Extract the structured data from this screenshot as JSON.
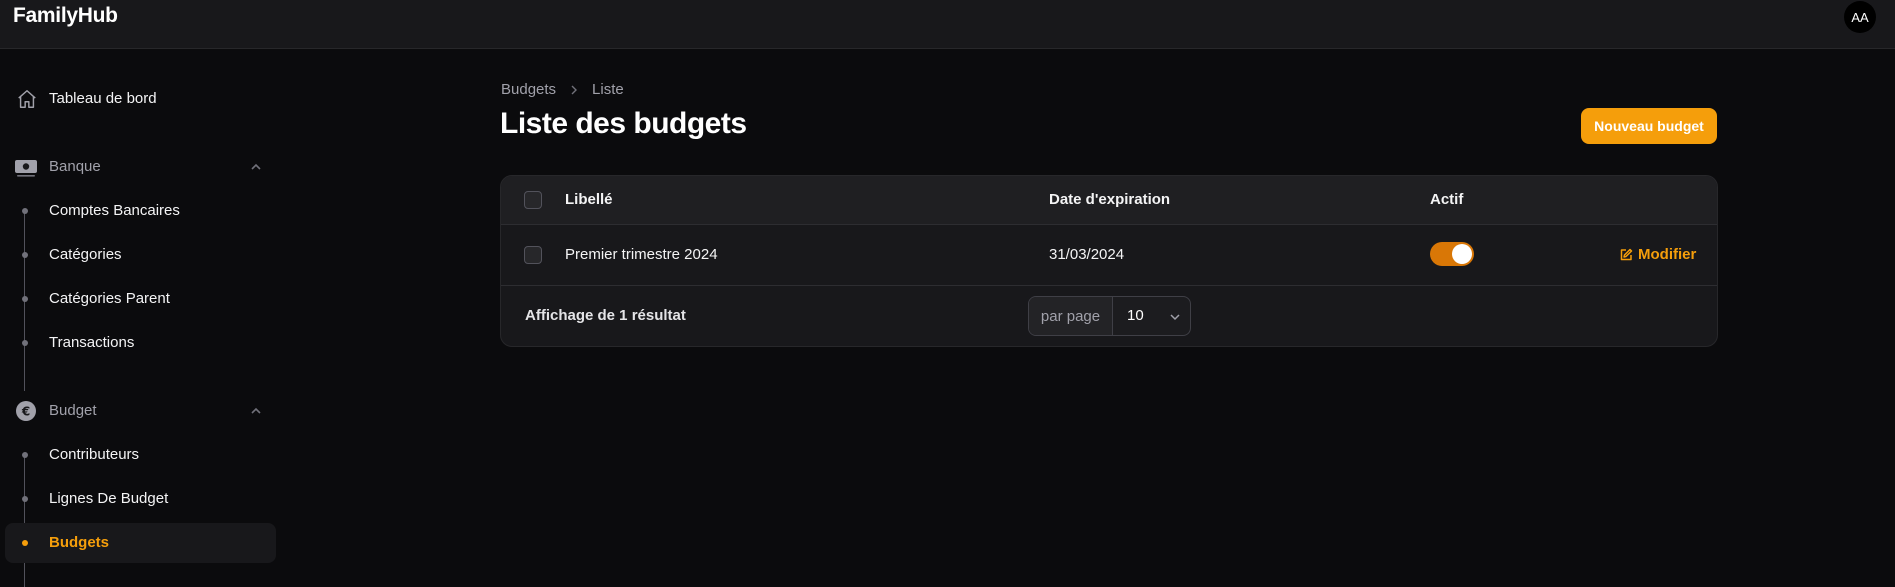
{
  "app": {
    "brand": "FamilyHub",
    "user_initials": "AA"
  },
  "sidebar": {
    "dashboard": {
      "label": "Tableau de bord",
      "icon": "home-icon"
    },
    "groups": [
      {
        "label": "Banque",
        "icon": "banknote-icon",
        "expanded": true,
        "items": [
          {
            "label": "Comptes Bancaires"
          },
          {
            "label": "Catégories"
          },
          {
            "label": "Catégories Parent"
          },
          {
            "label": "Transactions"
          }
        ]
      },
      {
        "label": "Budget",
        "icon": "euro-icon",
        "expanded": true,
        "items": [
          {
            "label": "Contributeurs"
          },
          {
            "label": "Lignes De Budget"
          },
          {
            "label": "Budgets",
            "active": true
          }
        ]
      }
    ]
  },
  "main": {
    "breadcrumb": [
      "Budgets",
      "Liste"
    ],
    "title": "Liste des budgets",
    "new_button": "Nouveau budget",
    "table": {
      "columns": [
        "Libellé",
        "Date d'expiration",
        "Actif"
      ],
      "rows": [
        {
          "label": "Premier trimestre 2024",
          "expiration": "31/03/2024",
          "active": true,
          "action": "Modifier"
        }
      ],
      "summary": "Affichage de 1 résultat",
      "per_page_label": "par page",
      "per_page_value": "10"
    }
  },
  "colors": {
    "accent": "#f59e0b",
    "toggle_on": "#d97706",
    "background": "#0b0b0d",
    "surface": "#18181b"
  }
}
